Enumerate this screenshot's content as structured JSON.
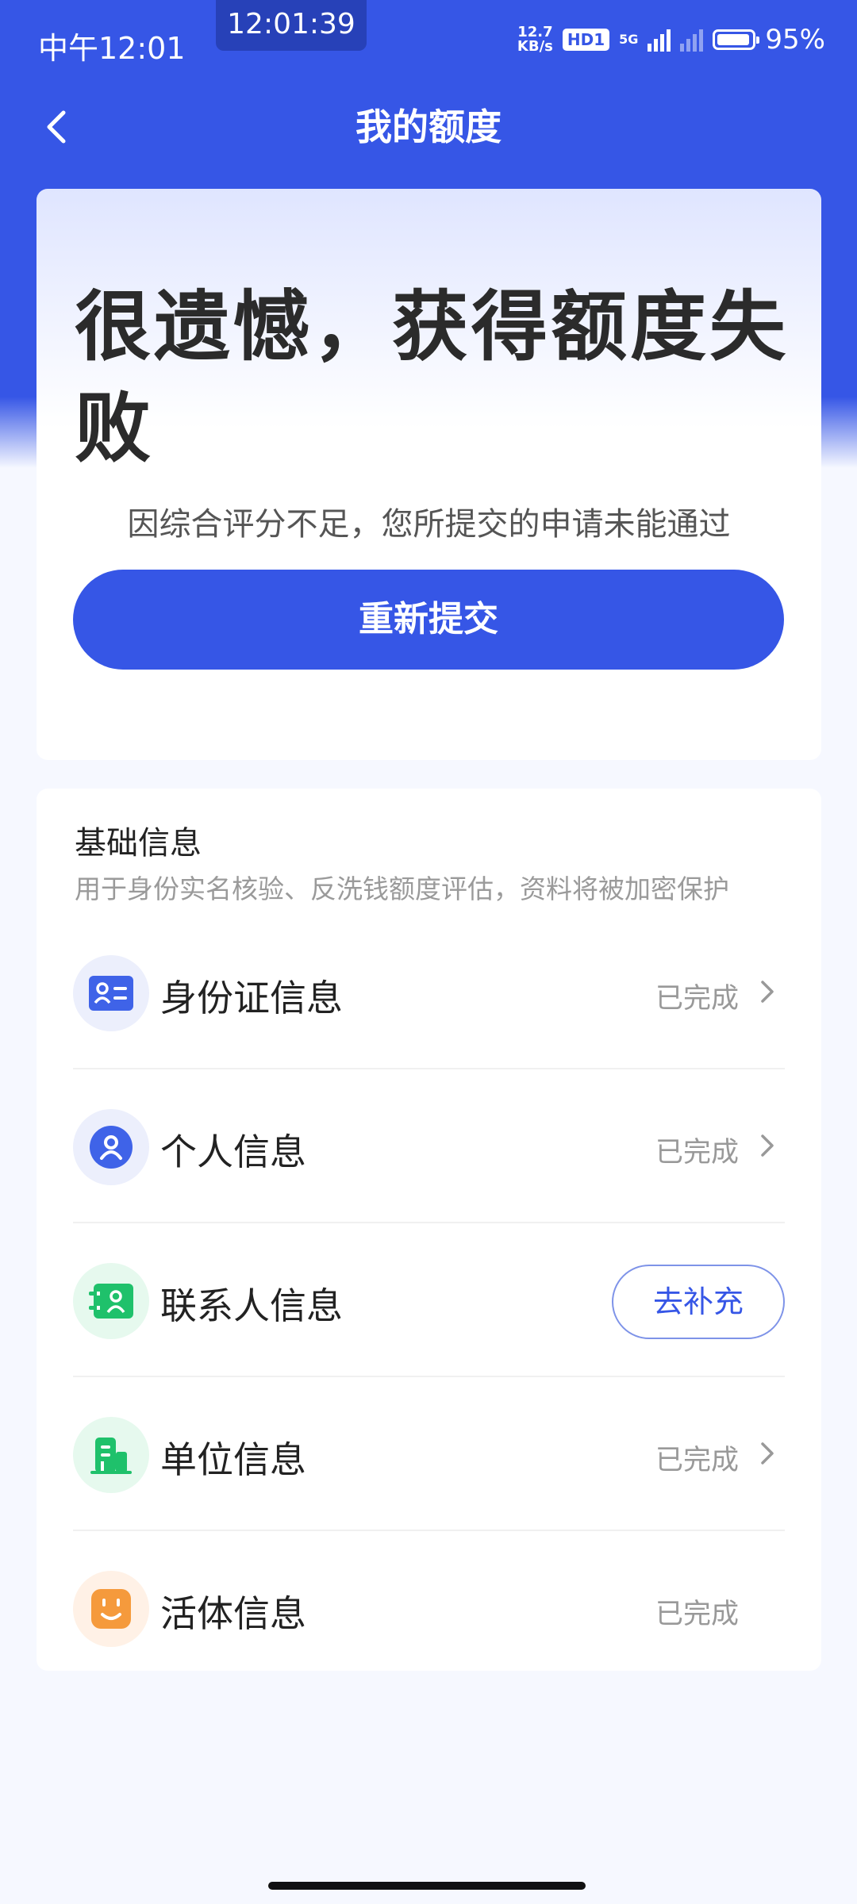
{
  "status_bar": {
    "time": "中午12:01",
    "recording_time": "12:01:39",
    "net_speed_value": "12.7",
    "net_speed_unit": "KB/s",
    "hd_label": "HD1",
    "network_label": "5G",
    "battery_percent": "95%",
    "battery_level": 0.95
  },
  "nav": {
    "title": "我的额度"
  },
  "result": {
    "title": "很遗憾，获得额度失败",
    "subtitle": "因综合评分不足，您所提交的申请未能通过",
    "resubmit_label": "重新提交"
  },
  "info": {
    "title": "基础信息",
    "description": "用于身份实名核验、反洗钱额度评估，资料将被加密保护",
    "rows": [
      {
        "label": "身份证信息",
        "status": "已完成",
        "icon": "id-card-icon",
        "icon_bg": "#eceffc",
        "icon_color": "#3f63e8"
      },
      {
        "label": "个人信息",
        "status": "已完成",
        "icon": "person-icon",
        "icon_bg": "#eceffc",
        "icon_color": "#3f63e8"
      },
      {
        "label": "联系人信息",
        "action": "去补充",
        "icon": "contact-icon",
        "icon_bg": "#e6f9ee",
        "icon_color": "#1fc16b"
      },
      {
        "label": "单位信息",
        "status": "已完成",
        "icon": "building-icon",
        "icon_bg": "#e6f9ee",
        "icon_color": "#1fc16b"
      },
      {
        "label": "活体信息",
        "status": "已完成",
        "icon": "face-icon",
        "icon_bg": "#fff1e6",
        "icon_color": "#f59a3c"
      }
    ]
  },
  "colors": {
    "brand": "#3656e6",
    "page_bg": "#f6f8ff"
  }
}
